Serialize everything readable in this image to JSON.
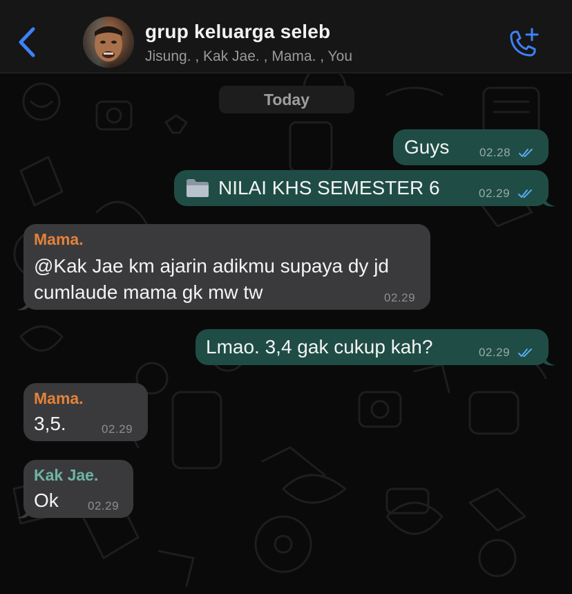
{
  "header": {
    "title": "grup keluarga seleb",
    "members": "Jisung. , Kak Jae. , Mama. , You"
  },
  "date_separator": "Today",
  "colors": {
    "accent": "#3e82f7",
    "outgoing_bubble": "#1f4d45",
    "incoming_bubble": "#3a3a3c",
    "read_ticks": "#5aa9f5",
    "sender_mama": "#e4823a",
    "sender_kak_jae": "#6fb4a3"
  },
  "messages": [
    {
      "direction": "out",
      "text": "Guys",
      "time": "02.28",
      "read": true
    },
    {
      "direction": "out",
      "icon": "folder-icon",
      "text": "NILAI KHS SEMESTER 6",
      "time": "02.29",
      "read": true
    },
    {
      "direction": "in",
      "sender": "Mama.",
      "lines": [
        "@Kak Jae km ajarin adikmu supaya dy jd",
        "cumlaude mama gk mw tw"
      ],
      "time": "02.29"
    },
    {
      "direction": "out",
      "text": "Lmao. 3,4 gak cukup kah?",
      "time": "02.29",
      "read": true
    },
    {
      "direction": "in",
      "sender": "Mama.",
      "text": "3,5.",
      "time": "02.29"
    },
    {
      "direction": "in",
      "sender": "Kak Jae.",
      "text": "Ok",
      "time": "02.29"
    }
  ]
}
